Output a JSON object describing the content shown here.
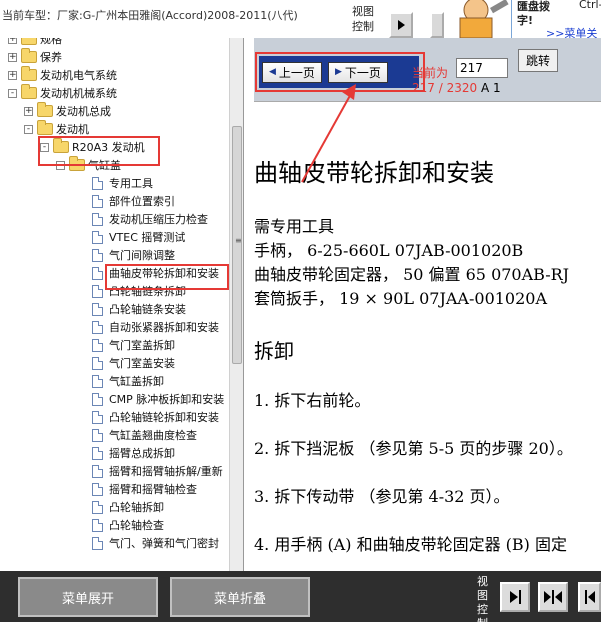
{
  "topbar": {
    "car_model": "当前车型：厂家:G-广州本田雅阁(Accord)2008-2011(八代)",
    "view_control": "视图控制",
    "promo_line1": "匯盘拨",
    "promo_line1b": "Ctrl-",
    "promo_line2": "字!",
    "promo_link": ">>菜单关"
  },
  "sidebar": {
    "items": [
      {
        "label": "规格",
        "kind": "folder",
        "expander": "+"
      },
      {
        "label": "保养",
        "kind": "folder",
        "expander": "+"
      },
      {
        "label": "发动机电气系统",
        "kind": "folder",
        "expander": "+"
      },
      {
        "label": "发动机机械系统",
        "kind": "folder",
        "expander": "-"
      },
      {
        "label": "发动机总成",
        "kind": "folder",
        "expander": "+"
      },
      {
        "label": "发动机",
        "kind": "folder",
        "expander": "-"
      },
      {
        "label": "R20A3 发动机",
        "kind": "folder",
        "expander": "-"
      },
      {
        "label": "气缸盖",
        "kind": "folder",
        "expander": "-"
      },
      {
        "label": "专用工具",
        "kind": "doc"
      },
      {
        "label": "部件位置索引",
        "kind": "doc"
      },
      {
        "label": "发动机压缩压力检查",
        "kind": "doc"
      },
      {
        "label": "VTEC 摇臂测试",
        "kind": "doc"
      },
      {
        "label": "气门间隙调整",
        "kind": "doc"
      },
      {
        "label": "曲轴皮带轮拆卸和安装",
        "kind": "doc"
      },
      {
        "label": "凸轮轴链条拆卸",
        "kind": "doc"
      },
      {
        "label": "凸轮轴链条安装",
        "kind": "doc"
      },
      {
        "label": "自动张紧器拆卸和安装",
        "kind": "doc"
      },
      {
        "label": "气门室盖拆卸",
        "kind": "doc"
      },
      {
        "label": "气门室盖安装",
        "kind": "doc"
      },
      {
        "label": "气缸盖拆卸",
        "kind": "doc"
      },
      {
        "label": "CMP 脉冲板拆卸和安装",
        "kind": "doc"
      },
      {
        "label": "凸轮轴链轮拆卸和安装",
        "kind": "doc"
      },
      {
        "label": "气缸盖翘曲度检查",
        "kind": "doc"
      },
      {
        "label": "摇臂总成拆卸",
        "kind": "doc"
      },
      {
        "label": "摇臂和摇臂轴拆解/重新",
        "kind": "doc"
      },
      {
        "label": "摇臂和摇臂轴检查",
        "kind": "doc"
      },
      {
        "label": "凸轮轴拆卸",
        "kind": "doc"
      },
      {
        "label": "凸轮轴检查",
        "kind": "doc"
      },
      {
        "label": "气门、弹簧和气门密封",
        "kind": "doc"
      }
    ]
  },
  "navigation": {
    "prev_label": "上一页",
    "next_label": "下一页",
    "current_label": "当前为",
    "page_value": "217",
    "jump_label": "跳转",
    "page_count": "217 / 2320",
    "page_extra": "A 1"
  },
  "document": {
    "title": "曲轴皮带轮拆卸和安装",
    "lines": [
      "需专用工具",
      "手柄， 6-25-660L 07JAB-001020B",
      "曲轴皮带轮固定器， 50 偏置 65 070AB-RJ",
      "套筒扳手， 19 × 90L 07JAA-001020A",
      "拆卸",
      "1. 拆下右前轮。",
      "2. 拆下挡泥板 （参见第 5-5 页的步骤 20）。",
      "3. 拆下传动带 （参见第 4-32 页）。",
      "4. 用手柄 (A) 和曲轴皮带轮固定器 (B) 固定"
    ]
  },
  "bottombar": {
    "expand_label": "菜单展开",
    "collapse_label": "菜单折叠",
    "view_control": "视图控制"
  },
  "colors": {
    "highlight_red": "#e53935",
    "nav_blue": "#1b3a93",
    "bottom_bar": "#2e2e2e"
  }
}
